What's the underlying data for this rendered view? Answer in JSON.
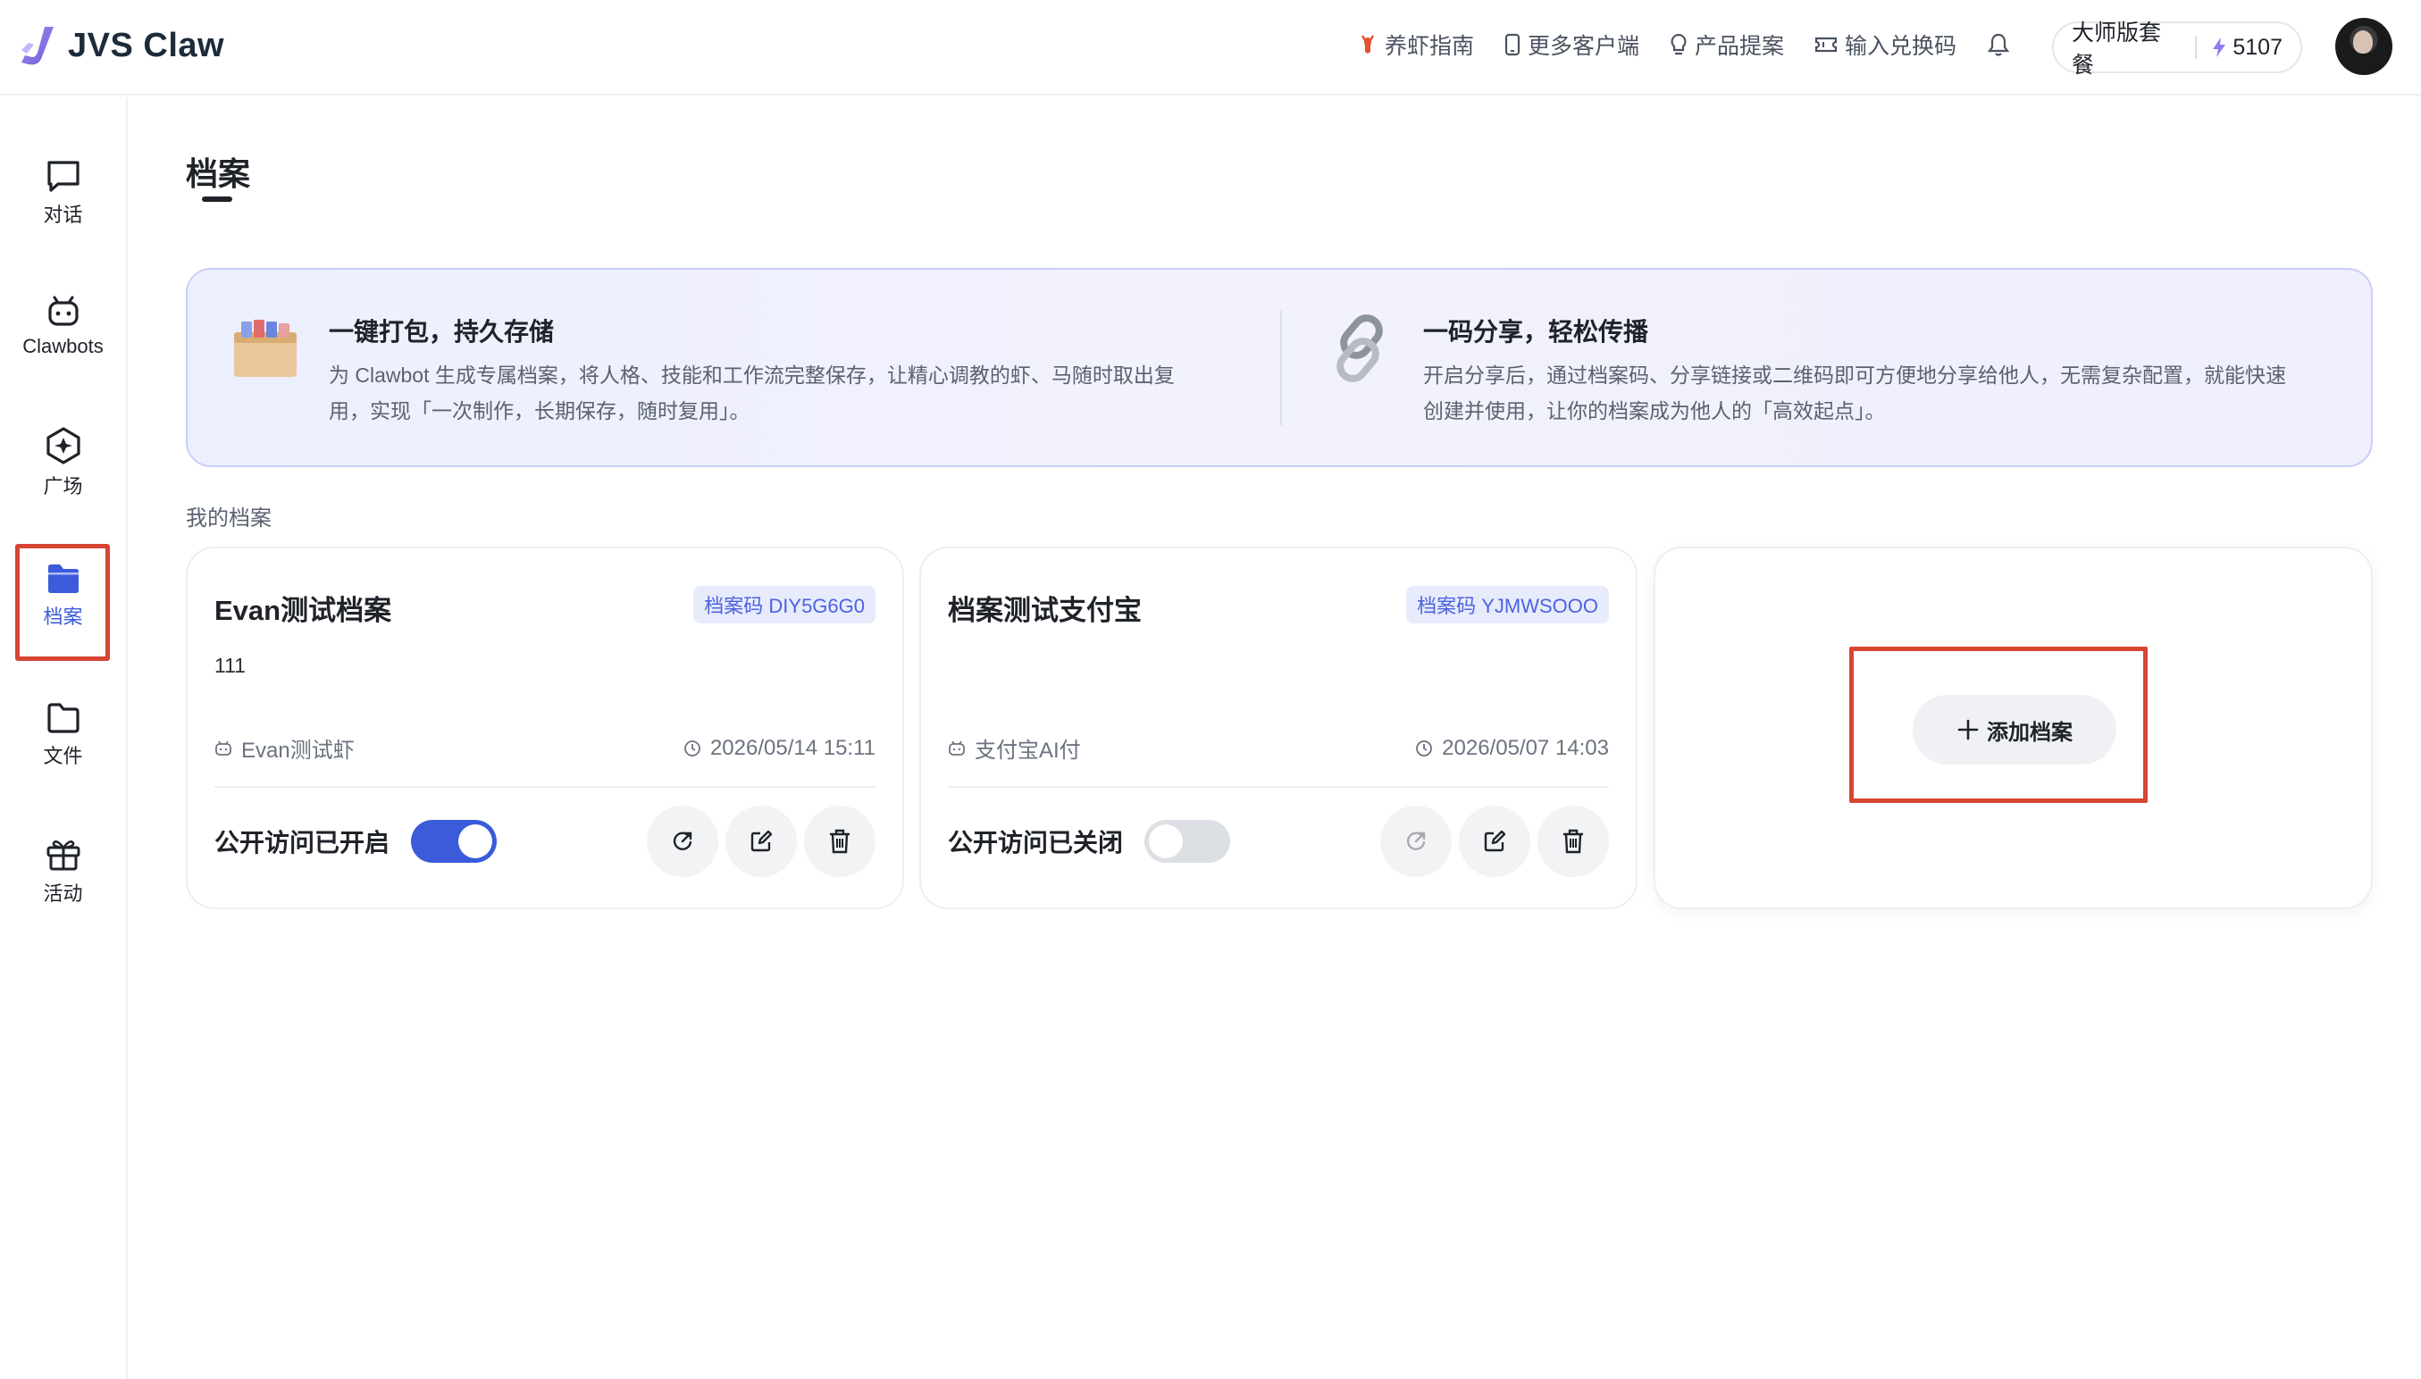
{
  "app": {
    "name": "JVS Claw"
  },
  "topnav": {
    "items": [
      {
        "label": "养虾指南",
        "icon": "lobster-icon"
      },
      {
        "label": "更多客户端",
        "icon": "phone-icon"
      },
      {
        "label": "产品提案",
        "icon": "lightbulb-icon"
      },
      {
        "label": "输入兑换码",
        "icon": "ticket-icon"
      }
    ],
    "plan": "大师版套餐",
    "credits": "5107"
  },
  "sidebar": {
    "items": [
      {
        "label": "对话",
        "icon": "chat-icon"
      },
      {
        "label": "Clawbots",
        "icon": "bot-icon"
      },
      {
        "label": "广场",
        "icon": "plaza-icon"
      },
      {
        "label": "档案",
        "icon": "folder-filled-icon",
        "active": true
      },
      {
        "label": "文件",
        "icon": "folder-icon"
      },
      {
        "label": "活动",
        "icon": "gift-icon"
      }
    ]
  },
  "page": {
    "title": "档案"
  },
  "banner": {
    "left": {
      "title": "一键打包，持久存储",
      "desc_line1": "为 Clawbot 生成专属档案，将人格、技能和工作流完整保存，让精心调教的虾、马随时取出复",
      "desc_line2": "用，实现「一次制作，长期保存，随时复用」。"
    },
    "right": {
      "title": "一码分享，轻松传播",
      "desc_line1": "开启分享后，通过档案码、分享链接或二维码即可方便地分享给他人，无需复杂配置，就能快速",
      "desc_line2": "创建并使用，让你的档案成为他人的「高效起点」。"
    }
  },
  "section": {
    "my_archives": "我的档案"
  },
  "cards": [
    {
      "name": "Evan测试档案",
      "code": "档案码 DIY5G6G0",
      "desc": "111",
      "bot": "Evan测试虾",
      "time": "2026/05/14 15:11",
      "public_label": "公开访问已开启",
      "public_on": true
    },
    {
      "name": "档案测试支付宝",
      "code": "档案码 YJMWSOOO",
      "desc": "",
      "bot": "支付宝AI付",
      "time": "2026/05/07 14:03",
      "public_label": "公开访问已关闭",
      "public_on": false
    }
  ],
  "add_card": {
    "label": "添加档案"
  },
  "colors": {
    "accent": "#3b5bdb",
    "highlight": "#d64532"
  }
}
